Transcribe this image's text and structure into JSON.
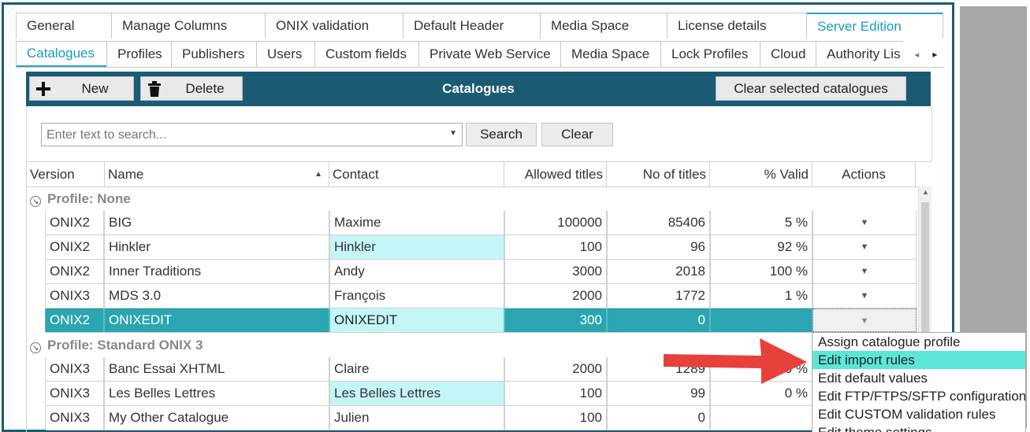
{
  "top_tabs": [
    {
      "label": "General",
      "active": false
    },
    {
      "label": "Manage Columns",
      "active": false
    },
    {
      "label": "ONIX validation",
      "active": false
    },
    {
      "label": "Default Header",
      "active": false
    },
    {
      "label": "Media Space",
      "active": false
    },
    {
      "label": "License details",
      "active": false
    },
    {
      "label": "Server Edition",
      "active": true
    }
  ],
  "sub_tabs": [
    {
      "label": "Catalogues",
      "active": true
    },
    {
      "label": "Profiles",
      "active": false
    },
    {
      "label": "Publishers",
      "active": false
    },
    {
      "label": "Users",
      "active": false
    },
    {
      "label": "Custom fields",
      "active": false
    },
    {
      "label": "Private Web Service",
      "active": false
    },
    {
      "label": "Media Space",
      "active": false
    },
    {
      "label": "Lock Profiles",
      "active": false
    },
    {
      "label": "Cloud",
      "active": false
    },
    {
      "label": "Authority Lis",
      "active": false
    }
  ],
  "toolbar": {
    "new_label": "New",
    "delete_label": "Delete",
    "title": "Catalogues",
    "clear_selected_label": "Clear selected catalogues"
  },
  "search": {
    "placeholder": "Enter text to search...",
    "search_label": "Search",
    "clear_label": "Clear"
  },
  "columns": [
    "Version",
    "Name",
    "Contact",
    "Allowed titles",
    "No of titles",
    "% Valid",
    "Actions"
  ],
  "groups": [
    {
      "label": "Profile: None",
      "rows": [
        {
          "version": "ONIX2",
          "name": "BIG",
          "contact": "Maxime",
          "allowed": "100000",
          "count": "85406",
          "valid": "5 %",
          "contact_highlight": false,
          "selected": false
        },
        {
          "version": "ONIX2",
          "name": "Hinkler",
          "contact": "Hinkler",
          "allowed": "100",
          "count": "96",
          "valid": "92 %",
          "contact_highlight": true,
          "selected": false
        },
        {
          "version": "ONIX2",
          "name": "Inner Traditions",
          "contact": "Andy",
          "allowed": "3000",
          "count": "2018",
          "valid": "100 %",
          "contact_highlight": false,
          "selected": false
        },
        {
          "version": "ONIX3",
          "name": "MDS 3.0",
          "contact": "François",
          "allowed": "2000",
          "count": "1772",
          "valid": "1 %",
          "contact_highlight": false,
          "selected": false
        },
        {
          "version": "ONIX2",
          "name": "ONIXEDIT",
          "contact": "ONIXEDIT",
          "allowed": "300",
          "count": "0",
          "valid": "",
          "contact_highlight": false,
          "selected": true
        }
      ]
    },
    {
      "label": "Profile: Standard ONIX 3",
      "rows": [
        {
          "version": "ONIX3",
          "name": "Banc Essai XHTML",
          "contact": "Claire",
          "allowed": "2000",
          "count": "1289",
          "valid": "0 %",
          "contact_highlight": false,
          "selected": false
        },
        {
          "version": "ONIX3",
          "name": "Les Belles Lettres",
          "contact": "Les Belles Lettres",
          "allowed": "100",
          "count": "99",
          "valid": "0 %",
          "contact_highlight": true,
          "selected": false
        },
        {
          "version": "ONIX3",
          "name": "My Other Catalogue",
          "contact": "Julien",
          "allowed": "100",
          "count": "0",
          "valid": "",
          "contact_highlight": false,
          "selected": false
        }
      ]
    }
  ],
  "actions_menu": [
    {
      "label": "Assign catalogue profile",
      "highlighted": false
    },
    {
      "label": "Edit import rules",
      "highlighted": true
    },
    {
      "label": "Edit default values",
      "highlighted": false
    },
    {
      "label": "Edit FTP/FTPS/SFTP configuration",
      "highlighted": false
    },
    {
      "label": "Edit CUSTOM validation rules",
      "highlighted": false
    },
    {
      "label": "Edit theme settings",
      "highlighted": false
    }
  ],
  "icons": {
    "new": "plus-icon",
    "delete": "trash-icon",
    "dropdown": "chevron-down-icon",
    "group_toggle": "collapse-circle-icon",
    "annotation": "red-arrow-icon"
  },
  "colors": {
    "toolbar_bg": "#1a5b73",
    "selected_row": "#2aa5b1",
    "cyan_highlight": "#c4f6f8",
    "menu_highlight": "#5ce6d8",
    "active_tab_text": "#1a9cc0",
    "annotation_arrow": "#e8403a"
  }
}
